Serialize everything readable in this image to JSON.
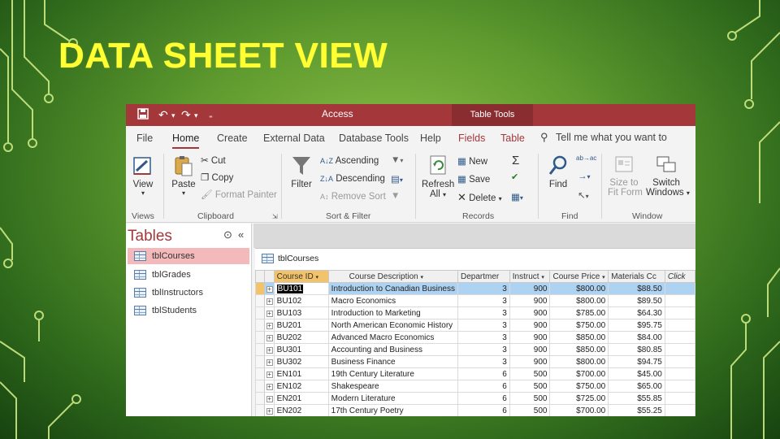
{
  "slide": {
    "title": "DATA SHEET VIEW"
  },
  "titlebar": {
    "app_name": "Access",
    "context_label": "Table Tools"
  },
  "tabs": [
    "File",
    "Home",
    "Create",
    "External Data",
    "Database Tools",
    "Help",
    "Fields",
    "Table"
  ],
  "active_tab": "Home",
  "tellme": "Tell me what you want to",
  "ribbon": {
    "views": {
      "view": "View",
      "label": "Views"
    },
    "clipboard": {
      "paste": "Paste",
      "cut": "Cut",
      "copy": "Copy",
      "format_painter": "Format Painter",
      "label": "Clipboard"
    },
    "sort_filter": {
      "filter": "Filter",
      "ascending": "Ascending",
      "descending": "Descending",
      "remove_sort": "Remove Sort",
      "label": "Sort & Filter"
    },
    "records": {
      "refresh": "Refresh",
      "all": "All",
      "new": "New",
      "save": "Save",
      "delete": "Delete",
      "label": "Records"
    },
    "find": {
      "find": "Find",
      "label": "Find"
    },
    "window": {
      "size_to": "Size to",
      "fit_form": "Fit Form",
      "switch": "Switch",
      "windows": "Windows",
      "label": "Window"
    }
  },
  "nav": {
    "title": "Tables",
    "items": [
      "tblCourses",
      "tblGrades",
      "tblInstructors",
      "tblStudents"
    ],
    "selected_index": 0
  },
  "document": {
    "tab_label": "tblCourses",
    "columns": [
      "Course ID",
      "Course Description",
      "Departmer",
      "Instruct",
      "Course Price",
      "Materials Cc",
      "Click"
    ],
    "rows": [
      [
        "BU101",
        "Introduction to Canadian Business",
        "3",
        "900",
        "$800.00",
        "$88.50"
      ],
      [
        "BU102",
        "Macro Economics",
        "3",
        "900",
        "$800.00",
        "$89.50"
      ],
      [
        "BU103",
        "Introduction to Marketing",
        "3",
        "900",
        "$785.00",
        "$64.30"
      ],
      [
        "BU201",
        "North American Economic History",
        "3",
        "900",
        "$750.00",
        "$95.75"
      ],
      [
        "BU202",
        "Advanced Macro Economics",
        "3",
        "900",
        "$850.00",
        "$84.00"
      ],
      [
        "BU301",
        "Accounting and Business",
        "3",
        "900",
        "$850.00",
        "$80.85"
      ],
      [
        "BU302",
        "Business Finance",
        "3",
        "900",
        "$800.00",
        "$94.75"
      ],
      [
        "EN101",
        "19th Century Literature",
        "6",
        "500",
        "$700.00",
        "$45.00"
      ],
      [
        "EN102",
        "Shakespeare",
        "6",
        "500",
        "$750.00",
        "$65.00"
      ],
      [
        "EN201",
        "Modern Literature",
        "6",
        "500",
        "$725.00",
        "$55.85"
      ],
      [
        "EN202",
        "17th Century Poetry",
        "6",
        "500",
        "$700.00",
        "$55.25"
      ]
    ],
    "current_row": 0
  },
  "colors": {
    "access_red": "#a4373a",
    "title_yellow": "#ffff33",
    "row_highlight": "#aed3f2",
    "header_selected": "#f3c36a"
  }
}
